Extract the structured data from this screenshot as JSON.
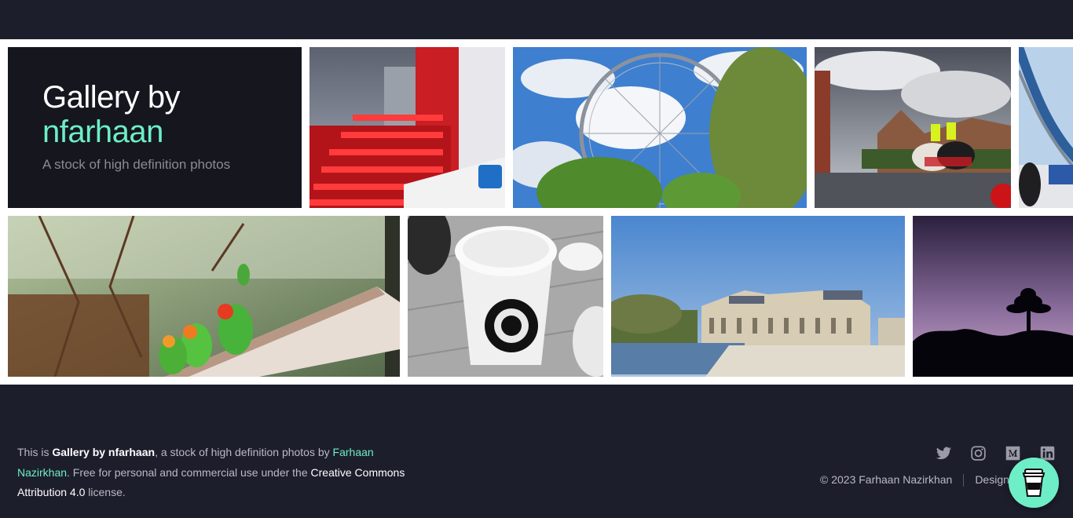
{
  "hero": {
    "title_line1": "Gallery by",
    "title_line2": "nfarhaan",
    "subtitle": "A stock of high definition photos"
  },
  "photos": [
    {
      "name": "red-building"
    },
    {
      "name": "london-eye"
    },
    {
      "name": "mounted-police"
    },
    {
      "name": "bridge"
    },
    {
      "name": "lovebirds"
    },
    {
      "name": "coffee-cup"
    },
    {
      "name": "palace"
    },
    {
      "name": "palm-silhouette"
    }
  ],
  "footer": {
    "text_prefix": "This is ",
    "site_name": "Gallery by nfarhaan",
    "text_mid": ", a stock of high definition photos by ",
    "author_link": "Farhaan Nazirkhan",
    "text_after_author": ". Free for personal and commercial use under the ",
    "license_name": "Creative Commons Attribution 4.0",
    "text_suffix": " license.",
    "copyright": "© 2023 Farhaan Nazirkhan",
    "design_label": "Design:",
    "socials": [
      "twitter-icon",
      "instagram-icon",
      "medium-icon",
      "linkedin-icon"
    ]
  },
  "colors": {
    "background": "#1d1e2c",
    "accent": "#6eeec6",
    "hero_bg": "#15161e"
  }
}
